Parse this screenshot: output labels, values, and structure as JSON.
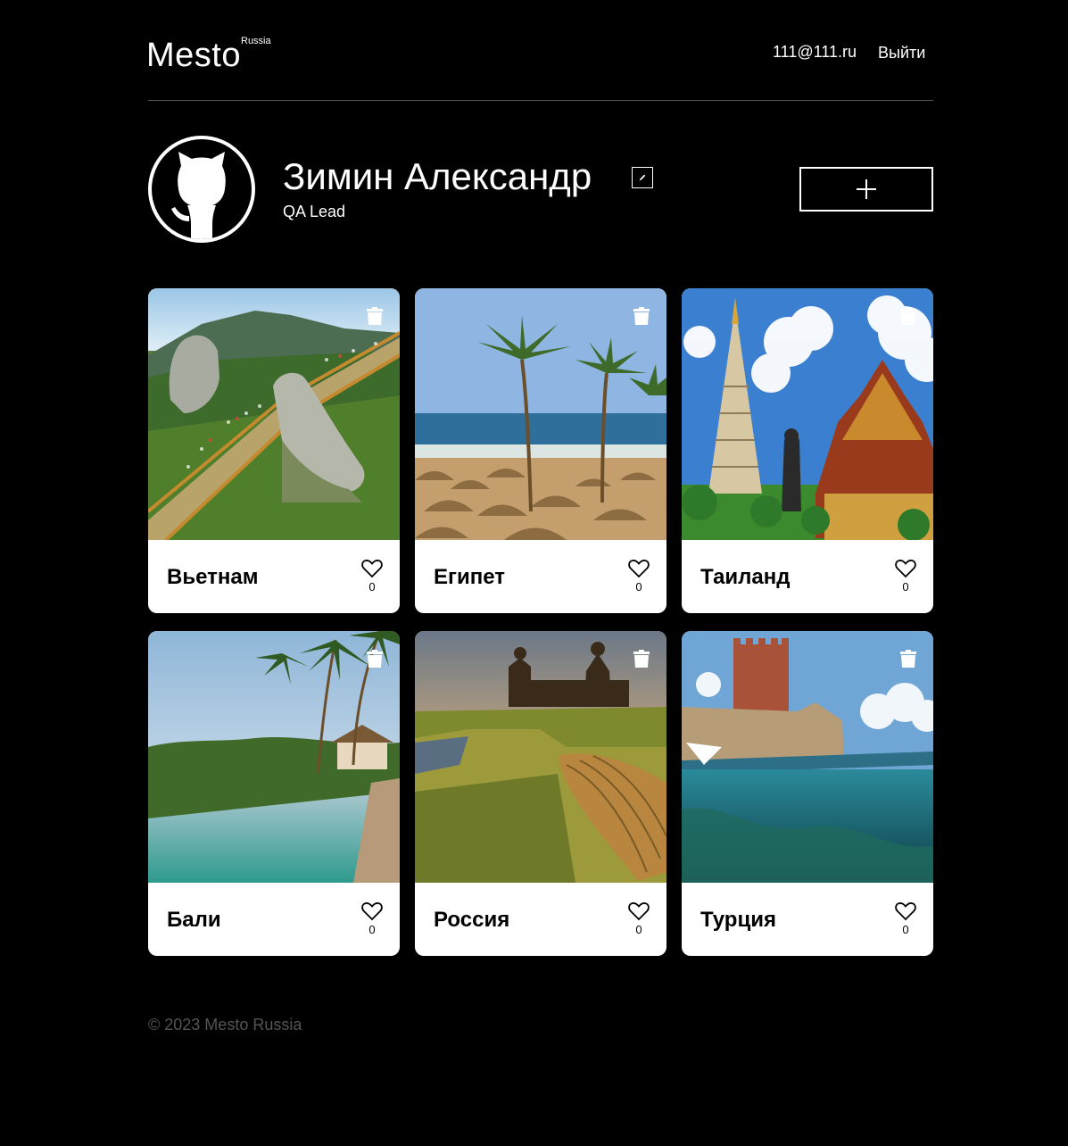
{
  "header": {
    "logo": "Mesto",
    "logo_sup": "Russia",
    "email": "111@111.ru",
    "logout_label": "Выйти"
  },
  "profile": {
    "name": "Зимин Александр",
    "about": "QA Lead",
    "avatar_icon": "github-octocat-icon",
    "edit_icon": "pencil-icon",
    "add_icon": "plus-icon"
  },
  "cards": [
    {
      "title": "Вьетнам",
      "likes": "0",
      "scene": "golden-bridge-hands"
    },
    {
      "title": "Египет",
      "likes": "0",
      "scene": "palm-beach-umbrellas"
    },
    {
      "title": "Таиланд",
      "likes": "0",
      "scene": "thai-temples"
    },
    {
      "title": "Бали",
      "likes": "0",
      "scene": "infinity-pool-jungle"
    },
    {
      "title": "Россия",
      "likes": "0",
      "scene": "wooden-church-boat"
    },
    {
      "title": "Турция",
      "likes": "0",
      "scene": "red-tower-sea"
    }
  ],
  "footer": {
    "copyright": "© 2023 Mesto Russia"
  },
  "colors": {
    "background": "#000000",
    "text": "#ffffff",
    "muted": "#545454",
    "card": "#ffffff"
  }
}
